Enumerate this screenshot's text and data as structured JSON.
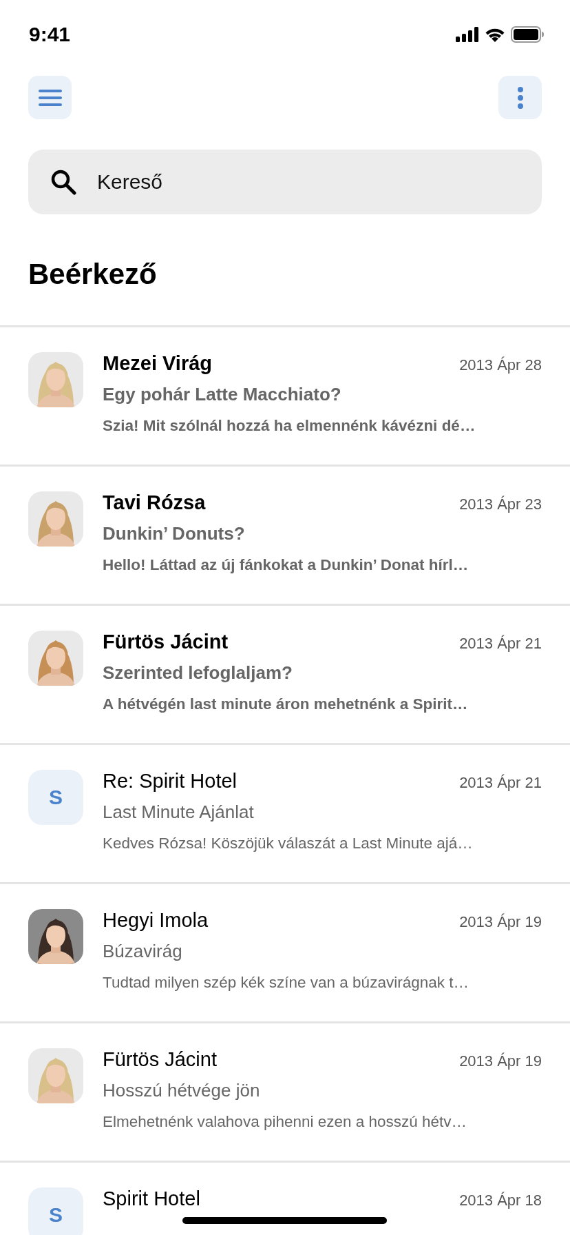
{
  "status_bar": {
    "time": "9:41"
  },
  "search": {
    "placeholder": "Kereső"
  },
  "title": "Beérkező",
  "messages": [
    {
      "sender": "Mezei Virág",
      "date": "2013 Ápr 28",
      "subject": "Egy pohár Latte Macchiato?",
      "preview": "Szia! Mit szólnál hozzá ha elmennénk kávézni dé…",
      "unread": true
    },
    {
      "sender": "Tavi Rózsa",
      "date": "2013 Ápr 23",
      "subject": "Dunkin’ Donuts?",
      "preview": "Hello! Láttad az új fánkokat a Dunkin’ Donat hírl…",
      "unread": true
    },
    {
      "sender": "Fürtös Jácint",
      "date": "2013 Ápr 21",
      "subject": "Szerinted lefoglaljam?",
      "preview": "A hétvégén last minute áron mehetnénk a Spirit…",
      "unread": true
    },
    {
      "sender": "Re: Spirit Hotel",
      "date": "2013 Ápr 21",
      "subject": "Last Minute Ajánlat",
      "preview": "Kedves Rózsa! Köszöjük válaszát a Last Minute ajá…",
      "unread": false,
      "avatar": {
        "kind": "initial",
        "letter": "S"
      }
    },
    {
      "sender": "Hegyi Imola",
      "date": "2013 Ápr 19",
      "subject": "Búzavirág",
      "preview": "Tudtad milyen szép kék színe van a búzavirágnak t…",
      "unread": false
    },
    {
      "sender": "Fürtös Jácint",
      "date": "2013 Ápr 19",
      "subject": "Hosszú hétvége jön",
      "preview": "Elmehetnénk valahova pihenni ezen a hosszú hétv…",
      "unread": false
    },
    {
      "sender": "Spirit Hotel",
      "date": "2013 Ápr 18",
      "unread": false,
      "avatar": {
        "kind": "initial",
        "letter": "S"
      }
    }
  ]
}
